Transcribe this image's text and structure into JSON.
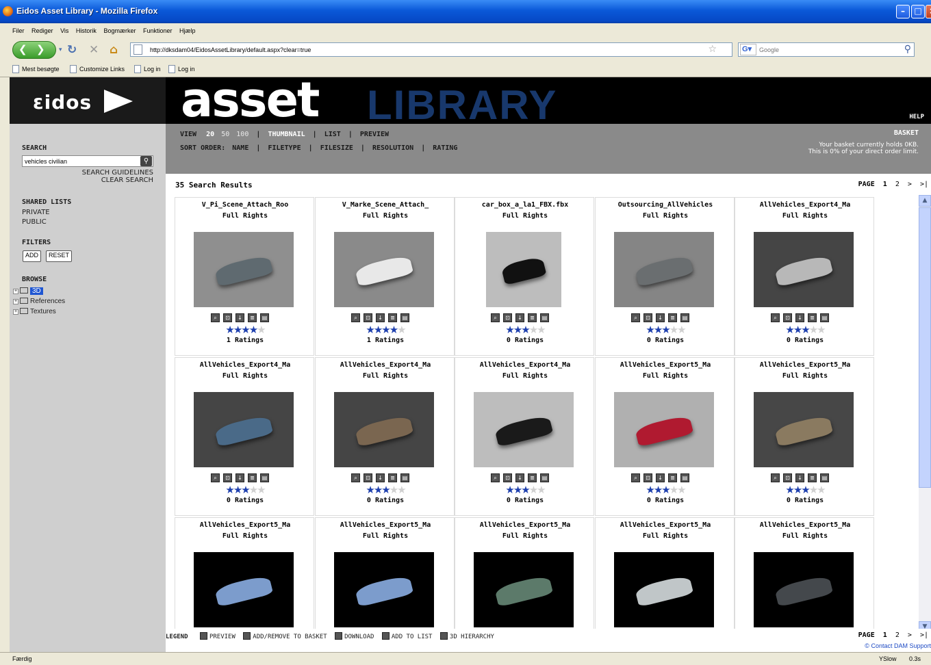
{
  "browser": {
    "title": "Eidos Asset Library - Mozilla Firefox",
    "menu": [
      "Filer",
      "Rediger",
      "Vis",
      "Historik",
      "Bogmærker",
      "Funktioner",
      "Hjælp"
    ],
    "url": "http://dksdam04/EidosAssetLibrary/default.aspx?clear=true",
    "search_placeholder": "Google",
    "bookmarks": [
      "Mest besøgte",
      "Customize Links",
      "Log in",
      "Log in"
    ],
    "status": "Færdig",
    "yslow": "YSlow",
    "load_time": "0.3s"
  },
  "header": {
    "word1": "asset",
    "word2": "LIBRARY",
    "help": "HELP",
    "logo_text": "εidos"
  },
  "sidebar": {
    "search_heading": "SEARCH",
    "search_value": "vehicles civilian",
    "search_guidelines": "SEARCH GUIDELINES",
    "clear_search": "CLEAR SEARCH",
    "shared_heading": "SHARED LISTS",
    "private": "PRIVATE",
    "public": "PUBLIC",
    "filters_heading": "FILTERS",
    "add": "ADD",
    "reset": "RESET",
    "browse_heading": "BROWSE",
    "tree": [
      "3D",
      "References",
      "Textures"
    ]
  },
  "toolbar": {
    "view_label": "VIEW",
    "counts": [
      "20",
      "50",
      "100"
    ],
    "thumbnail": "THUMBNAIL",
    "list": "LIST",
    "preview": "PREVIEW",
    "sort_label": "SORT ORDER:",
    "sort": [
      "NAME",
      "FILETYPE",
      "FILESIZE",
      "RESOLUTION",
      "RATING"
    ],
    "basket_title": "BASKET",
    "basket_line1": "Your basket currently holds 0KB.",
    "basket_line2": "This is 0% of your direct order limit."
  },
  "results": {
    "count_text": "35 Search Results",
    "page_label": "PAGE",
    "pages": [
      "1",
      "2",
      ">",
      ">|"
    ]
  },
  "assets": [
    {
      "name": "V_Pi_Scene_Attach_Roo",
      "rights": "Full Rights",
      "rating": 4,
      "ratings_text": "1 Ratings"
    },
    {
      "name": "V_Marke_Scene_Attach_",
      "rights": "Full Rights",
      "rating": 4,
      "ratings_text": "1 Ratings"
    },
    {
      "name": "car_box_a_la1_FBX.fbx",
      "rights": "Full Rights",
      "rating": 2.5,
      "ratings_text": "0 Ratings"
    },
    {
      "name": "Outsourcing_AllVehicles",
      "rights": "Full Rights",
      "rating": 2.5,
      "ratings_text": "0 Ratings"
    },
    {
      "name": "AllVehicles_Export4_Ma",
      "rights": "Full Rights",
      "rating": 2.5,
      "ratings_text": "0 Ratings"
    },
    {
      "name": "AllVehicles_Export4_Ma",
      "rights": "Full Rights",
      "rating": 2.5,
      "ratings_text": "0 Ratings"
    },
    {
      "name": "AllVehicles_Export4_Ma",
      "rights": "Full Rights",
      "rating": 2.5,
      "ratings_text": "0 Ratings"
    },
    {
      "name": "AllVehicles_Export4_Ma",
      "rights": "Full Rights",
      "rating": 2.5,
      "ratings_text": "0 Ratings"
    },
    {
      "name": "AllVehicles_Export5_Ma",
      "rights": "Full Rights",
      "rating": 2.5,
      "ratings_text": "0 Ratings"
    },
    {
      "name": "AllVehicles_Export5_Ma",
      "rights": "Full Rights",
      "rating": 2.5,
      "ratings_text": "0 Ratings"
    },
    {
      "name": "AllVehicles_Export5_Ma",
      "rights": "Full Rights",
      "rating": null,
      "ratings_text": ""
    },
    {
      "name": "AllVehicles_Export5_Ma",
      "rights": "Full Rights",
      "rating": null,
      "ratings_text": ""
    },
    {
      "name": "AllVehicles_Export5_Ma",
      "rights": "Full Rights",
      "rating": null,
      "ratings_text": ""
    },
    {
      "name": "AllVehicles_Export5_Ma",
      "rights": "Full Rights",
      "rating": null,
      "ratings_text": ""
    },
    {
      "name": "AllVehicles_Export5_Ma",
      "rights": "Full Rights",
      "rating": null,
      "ratings_text": ""
    }
  ],
  "thumb_styles": [
    "bg-grey-pickup",
    "bg-grey-truck",
    "bg-light-van",
    "bg-grey-sedan",
    "bg-dark-hatch",
    "bg-dark-car",
    "bg-dark-small",
    "bg-light-limos",
    "bg-light-red",
    "bg-dark-wall",
    "bg-black-blue",
    "bg-black-blue",
    "bg-black-green",
    "bg-black-silver",
    "bg-black-dark"
  ],
  "legend": {
    "label": "LEGEND",
    "preview": "PREVIEW",
    "basket": "ADD/REMOVE TO BASKET",
    "download": "DOWNLOAD",
    "add_list": "ADD TO LIST",
    "hierarchy": "3D HIERARCHY",
    "contact": "Contact DAM Support",
    "copyright": "©"
  },
  "colors": {
    "accent": "#1f56d2",
    "star_on": "#1d3fae",
    "star_off": "#d0d0d0",
    "header_bg": "#000000",
    "toolbar_bg": "#8a8a8a",
    "sidebar_bg": "#cfcfcf"
  }
}
